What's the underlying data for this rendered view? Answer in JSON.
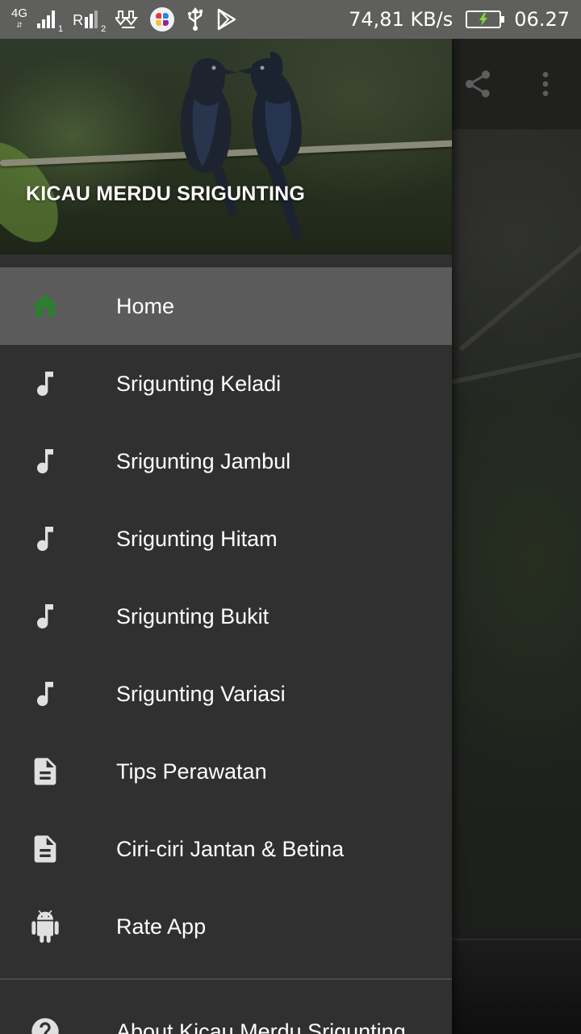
{
  "status_bar": {
    "network": "4G",
    "sim1_index": "1",
    "sim2_label": "R",
    "sim2_index": "2",
    "speed": "74,81 KB/s",
    "time": "06.27",
    "icons": [
      "network-4g-icon",
      "signal-icon",
      "download-icon",
      "app-icon",
      "usb-icon",
      "play-store-icon",
      "battery-charging-icon"
    ]
  },
  "app_bar": {
    "icons": [
      "share-icon",
      "more-vert-icon"
    ]
  },
  "drawer": {
    "header_title": "KICAU MERDU SRIGUNTING",
    "items": [
      {
        "label": "Home",
        "icon": "home-icon",
        "active": true
      },
      {
        "label": "Srigunting Keladi",
        "icon": "music-note-icon"
      },
      {
        "label": "Srigunting Jambul",
        "icon": "music-note-icon"
      },
      {
        "label": "Srigunting Hitam",
        "icon": "music-note-icon"
      },
      {
        "label": "Srigunting Bukit",
        "icon": "music-note-icon"
      },
      {
        "label": "Srigunting Variasi",
        "icon": "music-note-icon"
      },
      {
        "label": "Tips Perawatan",
        "icon": "document-icon"
      },
      {
        "label": "Ciri-ciri Jantan & Betina",
        "icon": "document-icon"
      },
      {
        "label": "Rate App",
        "icon": "android-icon"
      }
    ],
    "secondary_items": [
      {
        "label": "About Kicau Merdu Srigunting",
        "icon": "help-icon"
      }
    ]
  },
  "colors": {
    "drawer_bg": "#303030",
    "active_item_bg": "#5b5b5b",
    "home_icon": "#2e7d32",
    "item_icon": "#e0e0e0",
    "status_bar": "#5f5f5d"
  }
}
